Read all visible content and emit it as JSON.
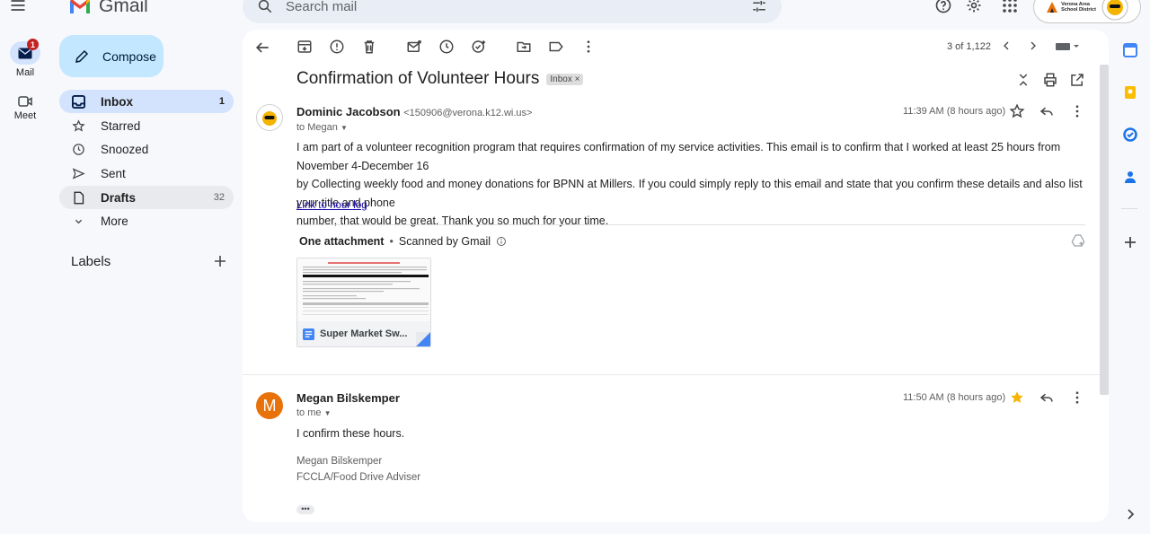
{
  "app": {
    "name": "Gmail"
  },
  "search": {
    "placeholder": "Search mail"
  },
  "rail": {
    "mail_label": "Mail",
    "mail_badge": "1",
    "meet_label": "Meet"
  },
  "compose": {
    "label": "Compose"
  },
  "sidebar": {
    "items": [
      {
        "label": "Inbox",
        "count": "1",
        "icon": "inbox-icon"
      },
      {
        "label": "Starred",
        "count": "",
        "icon": "star-icon"
      },
      {
        "label": "Snoozed",
        "count": "",
        "icon": "clock-icon"
      },
      {
        "label": "Sent",
        "count": "",
        "icon": "send-icon"
      },
      {
        "label": "Drafts",
        "count": "32",
        "icon": "draft-icon"
      },
      {
        "label": "More",
        "count": "",
        "icon": "chevron-down-icon"
      }
    ],
    "labels_title": "Labels"
  },
  "account": {
    "district_line1": "Verona Area",
    "district_line2": "School District"
  },
  "toolbar": {
    "pager": "3 of 1,122"
  },
  "thread": {
    "subject": "Confirmation of Volunteer Hours",
    "label_chip": "Inbox ×",
    "messages": [
      {
        "sender_name": "Dominic Jacobson",
        "sender_email": "<150906@verona.k12.wi.us>",
        "to": "to Megan",
        "time": "11:39 AM (8 hours ago)",
        "starred": false,
        "body_lines": [
          "I am part of a volunteer recognition program that requires confirmation of my service activities. This email is to confirm that I worked at least 25 hours from November 4-December 16",
          "by Collecting weekly food and money donations for BPNN at Millers. If you could simply reply to this email and state that you confirm these details and also list your title and phone",
          "number, that would be great. Thank you so much for your time."
        ],
        "link_text": "Link to hour log",
        "attachment_title": "One attachment",
        "attachment_scan": "Scanned by Gmail",
        "attachment_name": "Super Market Sw..."
      },
      {
        "sender_name": "Megan Bilskemper",
        "avatar_letter": "M",
        "to": "to me",
        "time": "11:50 AM (8 hours ago)",
        "starred": true,
        "body": "I confirm these hours.",
        "signature_line1": "Megan Bilskemper",
        "signature_line2": "FCCLA/Food Drive Adviser"
      }
    ]
  },
  "colors": {
    "accent": "#0b57d0",
    "compose_bg": "#c2e7ff",
    "active_item_bg": "#d3e3fd",
    "badge_red": "#c5221f",
    "avatar_orange": "#e8710a",
    "star_yellow": "#f4b400"
  }
}
